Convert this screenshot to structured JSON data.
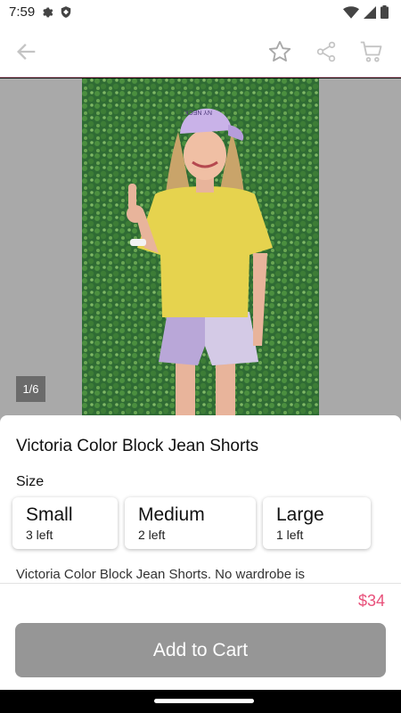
{
  "status_bar": {
    "time": "7:59"
  },
  "product": {
    "title": "Victoria Color Block Jean Shorts",
    "size_label": "Size",
    "sizes": [
      {
        "name": "Small",
        "stock": "3 left"
      },
      {
        "name": "Medium",
        "stock": "2 left"
      },
      {
        "name": "Large",
        "stock": "1 left"
      }
    ],
    "description": "Victoria Color Block Jean Shorts. No wardrobe is",
    "price": "$34",
    "add_to_cart_label": "Add to Cart"
  },
  "gallery": {
    "counter": "1/6",
    "cap_text": "NY NECK"
  },
  "colors": {
    "accent": "#e8507a",
    "button_disabled": "#969696"
  },
  "icons": [
    "back-arrow-icon",
    "star-icon",
    "share-icon",
    "cart-icon",
    "settings-icon",
    "shield-icon",
    "wifi-icon",
    "signal-icon",
    "battery-icon"
  ]
}
